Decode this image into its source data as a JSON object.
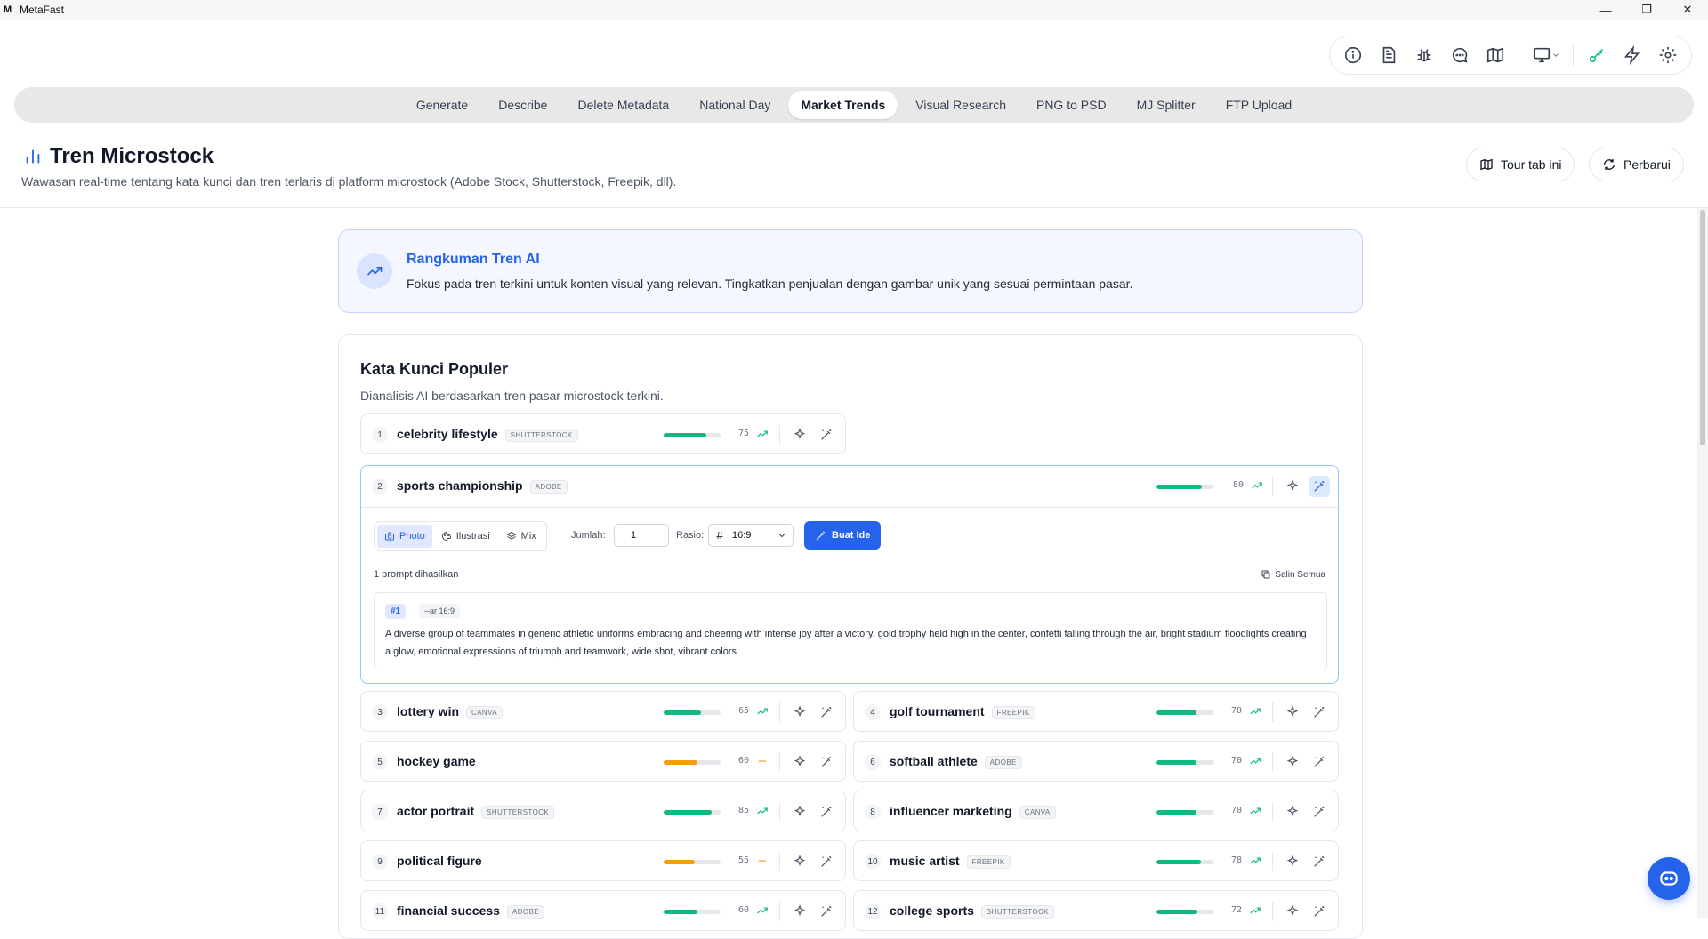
{
  "app": {
    "title": "MetaFast",
    "logo": "M"
  },
  "window_controls": {
    "minimize": "—",
    "restore": "❐",
    "close": "✕"
  },
  "toolbar": {
    "icons": [
      "info-icon",
      "document-icon",
      "bug-icon",
      "chat-icon",
      "map-icon",
      "monitor-icon",
      "key-icon",
      "lightning-icon",
      "gear-icon"
    ]
  },
  "tabs": [
    {
      "label": "Generate",
      "active": false
    },
    {
      "label": "Describe",
      "active": false
    },
    {
      "label": "Delete Metadata",
      "active": false
    },
    {
      "label": "National Day",
      "active": false
    },
    {
      "label": "Market Trends",
      "active": true
    },
    {
      "label": "Visual Research",
      "active": false
    },
    {
      "label": "PNG to PSD",
      "active": false
    },
    {
      "label": "MJ Splitter",
      "active": false
    },
    {
      "label": "FTP Upload",
      "active": false
    }
  ],
  "header": {
    "title": "Tren Microstock",
    "subtitle": "Wawasan real-time tentang kata kunci dan tren terlaris di platform microstock (Adobe Stock, Shutterstock, Freepik, dll).",
    "tour_label": "Tour tab ini",
    "refresh_label": "Perbarui"
  },
  "ai_summary": {
    "title": "Rangkuman Tren AI",
    "text": "Fokus pada tren terkini untuk konten visual yang relevan. Tingkatkan penjualan dengan gambar unik yang sesuai permintaan pasar."
  },
  "keywords_section": {
    "title": "Kata Kunci Populer",
    "subtitle": "Dianalisis AI berdasarkan tren pasar microstock terkini."
  },
  "keywords": [
    {
      "rank": "1",
      "name": "celebrity lifestyle",
      "source": "SHUTTERSTOCK",
      "score": "75",
      "level": 0.75,
      "trend": "up"
    },
    {
      "rank": "2",
      "name": "sports championship",
      "source": "ADOBE",
      "score": "80",
      "level": 0.8,
      "trend": "up"
    },
    {
      "rank": "3",
      "name": "lottery win",
      "source": "CANVA",
      "score": "65",
      "level": 0.65,
      "trend": "up"
    },
    {
      "rank": "4",
      "name": "golf tournament",
      "source": "FREEPIK",
      "score": "70",
      "level": 0.7,
      "trend": "up"
    },
    {
      "rank": "5",
      "name": "hockey game",
      "source": "",
      "score": "60",
      "level": 0.6,
      "trend": "flat"
    },
    {
      "rank": "6",
      "name": "softball athlete",
      "source": "ADOBE",
      "score": "70",
      "level": 0.7,
      "trend": "up"
    },
    {
      "rank": "7",
      "name": "actor portrait",
      "source": "SHUTTERSTOCK",
      "score": "85",
      "level": 0.85,
      "trend": "up"
    },
    {
      "rank": "8",
      "name": "influencer marketing",
      "source": "CANVA",
      "score": "70",
      "level": 0.7,
      "trend": "up"
    },
    {
      "rank": "9",
      "name": "political figure",
      "source": "",
      "score": "55",
      "level": 0.55,
      "trend": "flat"
    },
    {
      "rank": "10",
      "name": "music artist",
      "source": "FREEPIK",
      "score": "78",
      "level": 0.78,
      "trend": "up"
    },
    {
      "rank": "11",
      "name": "financial success",
      "source": "ADOBE",
      "score": "60",
      "level": 0.6,
      "trend": "up"
    },
    {
      "rank": "12",
      "name": "college sports",
      "source": "SHUTTERSTOCK",
      "score": "72",
      "level": 0.72,
      "trend": "up"
    }
  ],
  "generator": {
    "modes": [
      {
        "label": "Photo",
        "active": true
      },
      {
        "label": "Ilustrasi",
        "active": false
      },
      {
        "label": "Mix",
        "active": false
      }
    ],
    "qty_label": "Jumlah:",
    "qty_value": "1",
    "ratio_label": "Rasio:",
    "ratio_value": "16:9",
    "generate_label": "Buat Ide",
    "prompt_count": "1 prompt dihasilkan",
    "copy_all_label": "Salin Semua",
    "prompts": [
      {
        "index": "#1",
        "ar": "--ar 16:9",
        "text": "A diverse group of teammates in generic athletic uniforms embracing and cheering with intense joy after a victory, gold trophy held high in the center, confetti falling through the air, bright stadium floodlights creating a glow, emotional expressions of triumph and teamwork, wide shot, vibrant colors"
      }
    ]
  },
  "colors": {
    "accent": "#2563eb",
    "trend_up": "#10b981",
    "trend_flat": "#f59e0b"
  }
}
